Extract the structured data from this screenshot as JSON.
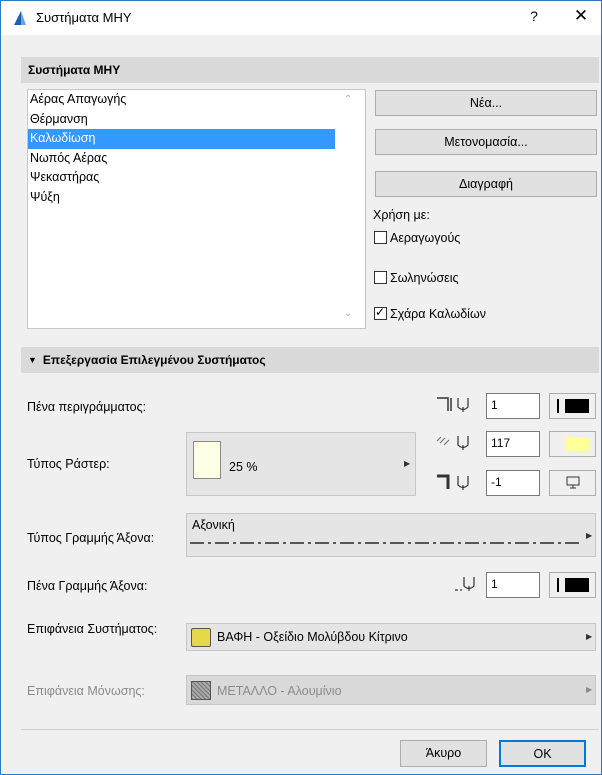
{
  "window": {
    "title": "Συστήματα ΜΗΥ",
    "help": "?",
    "close": "✕"
  },
  "systems": {
    "header": "Συστήματα ΜΗΥ",
    "items": [
      {
        "label": "Αέρας Απαγωγής"
      },
      {
        "label": "Θέρμανση"
      },
      {
        "label": "Καλωδίωση"
      },
      {
        "label": "Νωπός Αέρας"
      },
      {
        "label": "Ψεκαστήρας"
      },
      {
        "label": "Ψύξη"
      }
    ],
    "selected": "Καλωδίωση",
    "new_label": "Νέα...",
    "rename_label": "Μετονομασία...",
    "delete_label": "Διαγραφή",
    "use_with_label": "Χρήση με:",
    "use_with": [
      {
        "label": "Αεραγωγούς",
        "checked": false
      },
      {
        "label": "Σωληνώσεις",
        "checked": false
      },
      {
        "label": "Σχάρα Καλωδίων",
        "checked": true
      }
    ]
  },
  "edit": {
    "header": "Επεξεργασία Επιλεγμένου Συστήματος",
    "contour_pen_label": "Πένα περιγράμματος:",
    "contour_pen_value": "1",
    "fill_type_label": "Τύπος Ράστερ:",
    "fill_type_value": "25 %",
    "fill_fg_pen_value": "117",
    "fill_bg_pen_value": "-1",
    "axis_line_type_label": "Τύπος Γραμμής Άξονα:",
    "axis_line_type_value": "Αξονική",
    "axis_pen_label": "Πένα Γραμμής Άξονα:",
    "axis_pen_value": "1",
    "system_surface_label": "Επιφάνεια Συστήματος:",
    "system_surface_value": "ΒΑΦΗ - Οξείδιο Μολύβδου Κίτρινο",
    "insulation_surface_label": "Επιφάνεια Μόνωσης:",
    "insulation_surface_value": "ΜΕΤΑΛΛΟ - Αλουμίνιο"
  },
  "footer": {
    "cancel_label": "Άκυρο",
    "ok_label": "OK"
  },
  "colors": {
    "selection": "#3399ff",
    "accent": "#2b79c2",
    "yellow_fill": "#ffffc8",
    "surface_yellow": "#e5d84a"
  }
}
